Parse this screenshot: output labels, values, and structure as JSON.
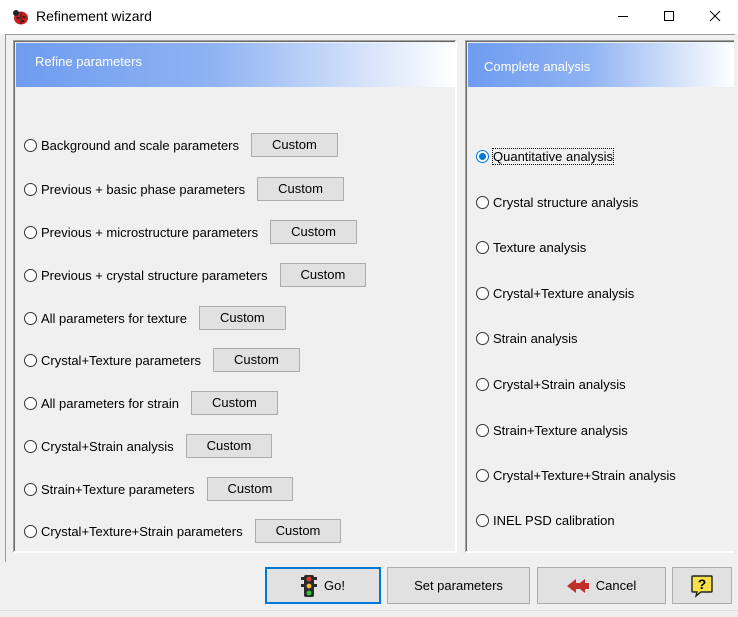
{
  "window": {
    "title": "Refinement wizard",
    "app_icon": "ladybug-icon",
    "controls": [
      "minimize-icon",
      "maximize-icon",
      "close-icon"
    ]
  },
  "refine_panel": {
    "header": "Refine parameters",
    "options": [
      {
        "label": "Background and scale parameters",
        "button": "Custom",
        "checked": false
      },
      {
        "label": "Previous + basic phase parameters",
        "button": "Custom",
        "checked": false
      },
      {
        "label": "Previous + microstructure parameters",
        "button": "Custom",
        "checked": false
      },
      {
        "label": "Previous + crystal structure parameters",
        "button": "Custom",
        "checked": false
      },
      {
        "label": "All parameters for texture",
        "button": "Custom",
        "checked": false
      },
      {
        "label": "Crystal+Texture parameters",
        "button": "Custom",
        "checked": false
      },
      {
        "label": "All parameters for strain",
        "button": "Custom",
        "checked": false
      },
      {
        "label": "Crystal+Strain analysis",
        "button": "Custom",
        "checked": false
      },
      {
        "label": "Strain+Texture parameters",
        "button": "Custom",
        "checked": false
      },
      {
        "label": "Crystal+Texture+Strain parameters",
        "button": "Custom",
        "checked": false
      }
    ]
  },
  "analysis_panel": {
    "header": "Complete analysis",
    "options": [
      {
        "label": "Quantitative analysis",
        "checked": true
      },
      {
        "label": "Crystal structure analysis",
        "checked": false
      },
      {
        "label": "Texture analysis",
        "checked": false
      },
      {
        "label": "Crystal+Texture analysis",
        "checked": false
      },
      {
        "label": "Strain analysis",
        "checked": false
      },
      {
        "label": "Crystal+Strain analysis",
        "checked": false
      },
      {
        "label": "Strain+Texture analysis",
        "checked": false
      },
      {
        "label": "Crystal+Texture+Strain analysis",
        "checked": false
      },
      {
        "label": "INEL PSD calibration",
        "checked": false
      }
    ]
  },
  "buttons": {
    "go": {
      "label": "Go!",
      "icon": "traffic-light-icon"
    },
    "set_parameters": {
      "label": "Set parameters"
    },
    "cancel": {
      "label": "Cancel",
      "icon": "back-arrows-icon"
    },
    "help": {
      "label": "?",
      "icon": "help-speech-bubble-icon"
    }
  },
  "colors": {
    "header_gradient_start": "#6f9cef",
    "header_gradient_end": "#ffffff",
    "selected_radio": "#0078d7",
    "default_button_border": "#0078d7"
  }
}
